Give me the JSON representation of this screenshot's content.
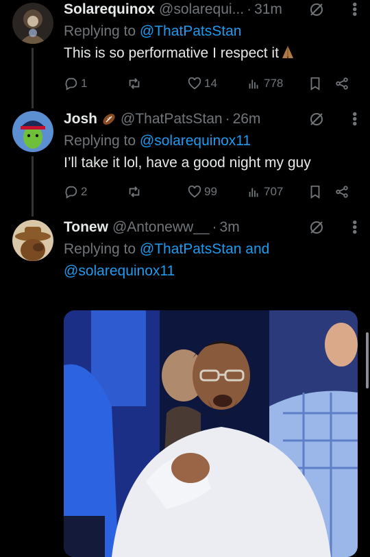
{
  "tweets": [
    {
      "name": "Solarequinox",
      "handle": "@solarequi...",
      "time": "31m",
      "replying_prefix": "Replying to ",
      "replying_to": "@ThatPatsStan",
      "replying_and": "",
      "replying_to2": "",
      "text": "This is so performative I respect it",
      "emoji": "folded-hands-emoji",
      "replies": "1",
      "reposts": "",
      "likes": "14",
      "views": "778"
    },
    {
      "name": "Josh",
      "name_emoji": "football-emoji",
      "handle": "@ThatPatsStan",
      "time": "26m",
      "replying_prefix": "Replying to ",
      "replying_to": "@solarequinox11",
      "text": "I’ll take it lol, have a good night my guy",
      "replies": "2",
      "reposts": "",
      "likes": "99",
      "views": "707"
    },
    {
      "name": "Tonew",
      "handle": "@Antoneww__",
      "time": "3m",
      "replying_prefix": "Replying to ",
      "replying_to": "@ThatPatsStan",
      "replying_and": " and",
      "replying_to2": "@solarequinox11",
      "media": "photo of man in white sweater clapping at a game"
    }
  ],
  "separator": "·",
  "colors": {
    "background": "#000000",
    "text": "#e7e9ea",
    "muted": "#71767b",
    "link": "#1d9bf0"
  }
}
